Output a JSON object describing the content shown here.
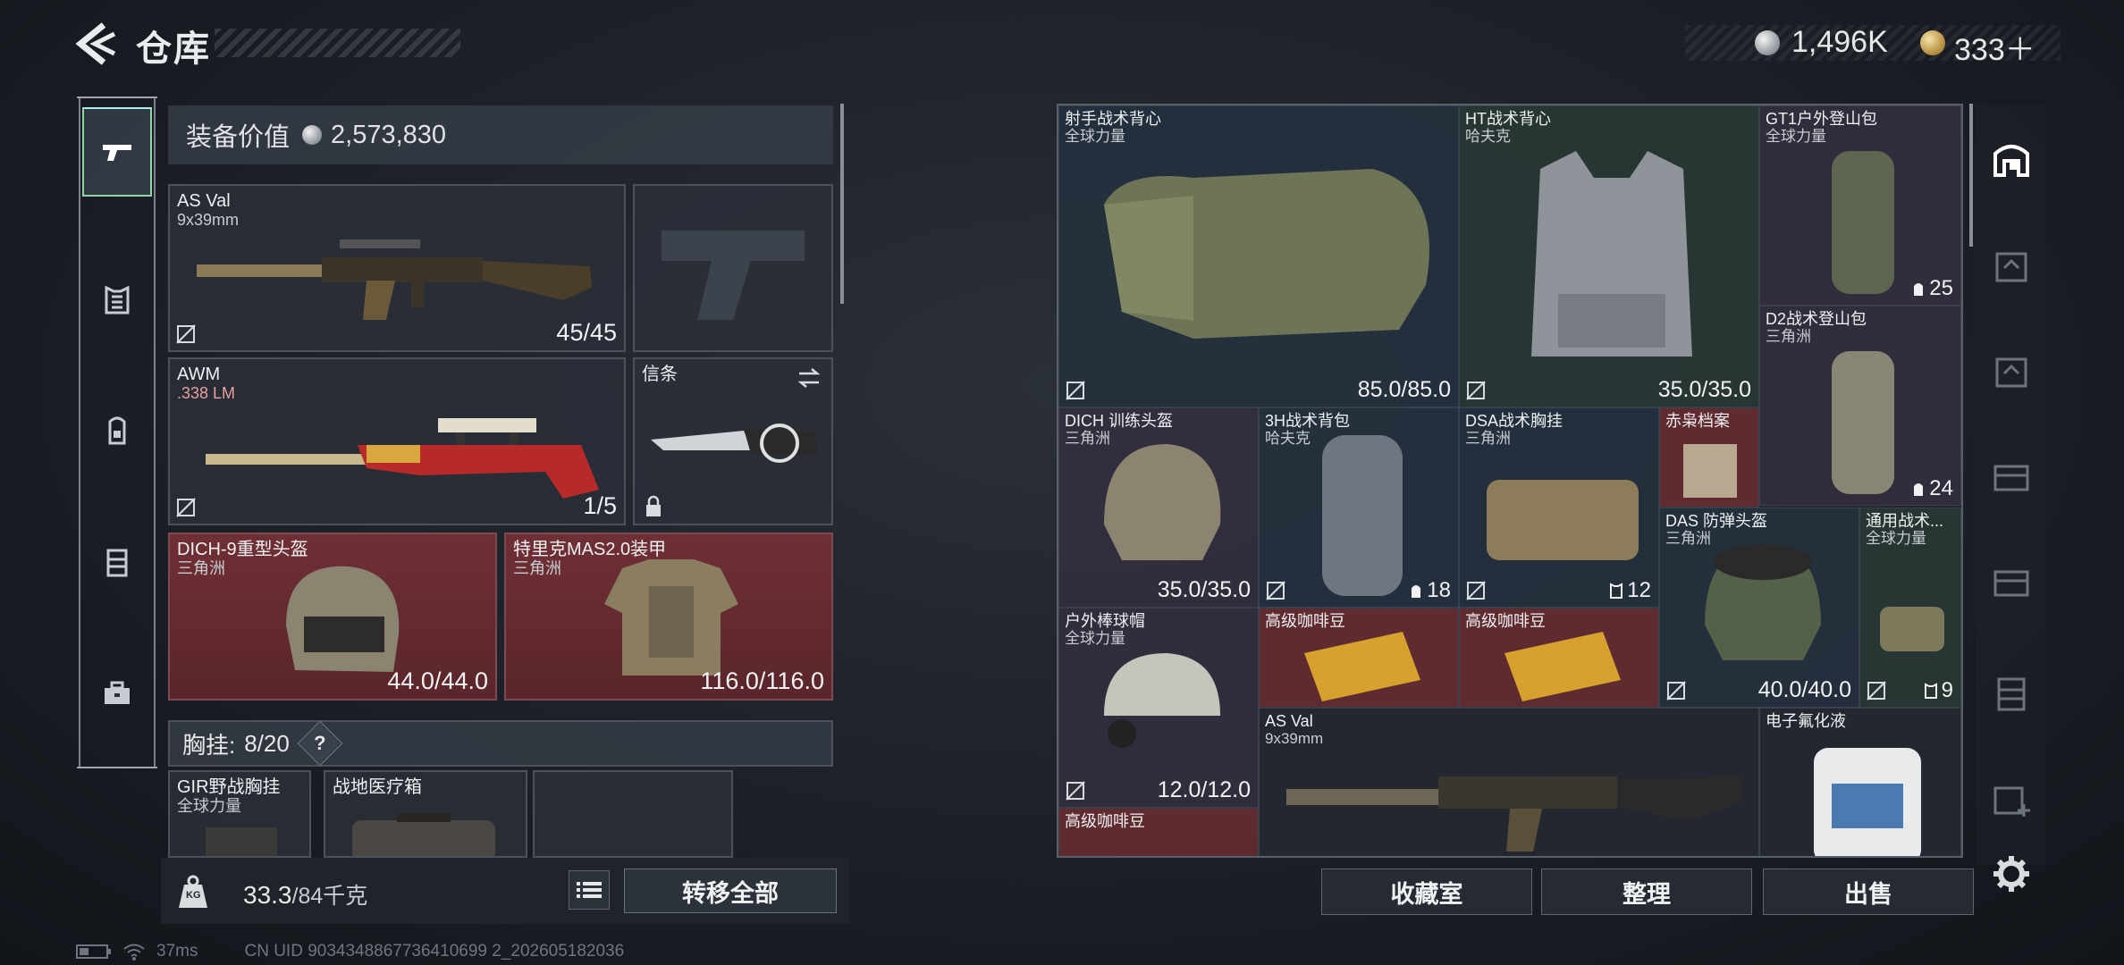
{
  "header": {
    "title": "仓库",
    "currency_silver": "1,496K",
    "currency_gold": "333＋"
  },
  "rail": {
    "items": [
      {
        "icon": "gun-icon",
        "active": true
      },
      {
        "icon": "armor-icon",
        "active": false
      },
      {
        "icon": "backpack-icon",
        "active": false
      },
      {
        "icon": "locker-icon",
        "active": false
      },
      {
        "icon": "toolbox-icon",
        "active": false
      }
    ]
  },
  "equipment": {
    "value_label": "装备价值",
    "value": "2,573,830",
    "slots": [
      {
        "name": "AS Val",
        "sub": "9x39mm",
        "value": "45/45"
      },
      {
        "name": "AWM",
        "sub": ".338 LM",
        "value": "1/5"
      },
      {
        "name": "信条",
        "sub": "",
        "value": ""
      },
      {
        "name": "DICH-9重型头盔",
        "sub": "三角洲",
        "value": "44.0/44.0"
      },
      {
        "name": "特里克MAS2.0装甲",
        "sub": "三角洲",
        "value": "116.0/116.0"
      }
    ],
    "rig_label": "胸挂:",
    "rig_count": "8",
    "rig_total": "/20",
    "help": "?",
    "rig_items": [
      {
        "name": "GIR野战胸挂",
        "sub": "全球力量"
      },
      {
        "name": "战地医疗箱",
        "sub": ""
      }
    ]
  },
  "bottom": {
    "weight_current": "33.3",
    "weight_max": "/84千克",
    "kg_label": "KG",
    "transfer_label": "转移全部"
  },
  "status": {
    "ping": "37ms",
    "uid": "CN UID 9034348867736410699 2_202605182036"
  },
  "grid": {
    "items": [
      {
        "name": "射手战术背心",
        "sub": "全球力量",
        "value": "85.0/85.0"
      },
      {
        "name": "HT战术背心",
        "sub": "哈夫克",
        "value": "35.0/35.0"
      },
      {
        "name": "GT1户外登山包",
        "sub": "全球力量",
        "value": "25"
      },
      {
        "name": "D2战术登山包",
        "sub": "三角洲",
        "value": "24"
      },
      {
        "name": "DICH 训练头盔",
        "sub": "三角洲",
        "value": "35.0/35.0"
      },
      {
        "name": "3H战术背包",
        "sub": "哈夫克",
        "value": "18"
      },
      {
        "name": "DSA战术胸挂",
        "sub": "三角洲",
        "value": "12"
      },
      {
        "name": "赤枭档案",
        "sub": "",
        "value": ""
      },
      {
        "name": "DAS 防弹头盔",
        "sub": "三角洲",
        "value": "40.0/40.0"
      },
      {
        "name": "通用战术...",
        "sub": "全球力量",
        "value": "9"
      },
      {
        "name": "户外棒球帽",
        "sub": "全球力量",
        "value": "12.0/12.0"
      },
      {
        "name": "高级咖啡豆",
        "sub": "",
        "value": ""
      },
      {
        "name": "高级咖啡豆",
        "sub": "",
        "value": ""
      },
      {
        "name": "AS Val",
        "sub": "9x39mm",
        "value": ""
      },
      {
        "name": "电子氟化液",
        "sub": "",
        "value": ""
      },
      {
        "name": "高级咖啡豆",
        "sub": "",
        "value": ""
      }
    ]
  },
  "actions": {
    "collection": "收藏室",
    "sort": "整理",
    "sell": "出售"
  }
}
